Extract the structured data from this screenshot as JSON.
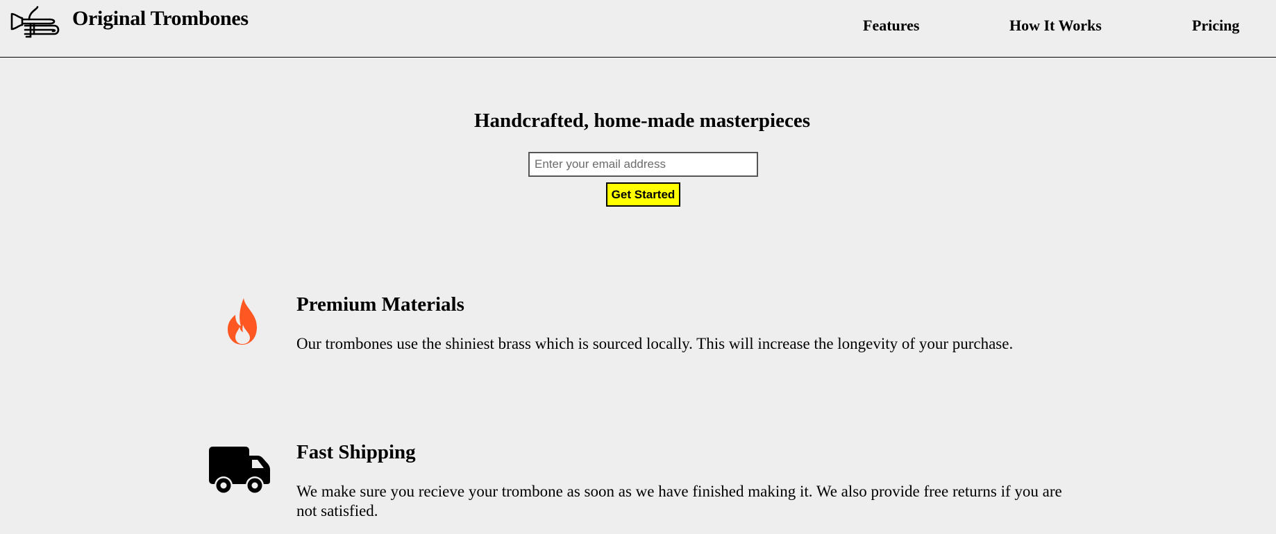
{
  "header": {
    "brand": "Original Trombones",
    "logo_icon": "trombone-icon",
    "nav": {
      "features": "Features",
      "how_it_works": "How It Works",
      "pricing": "Pricing"
    }
  },
  "hero": {
    "title": "Handcrafted, home-made masterpieces",
    "email_placeholder": "Enter your email address",
    "email_value": "",
    "submit_label": "Get Started",
    "submit_color": "#ffff00"
  },
  "features": [
    {
      "icon": "flame-icon",
      "title": "Premium Materials",
      "description": "Our trombones use the shiniest brass which is sourced locally. This will increase the longevity of your purchase."
    },
    {
      "icon": "truck-icon",
      "title": "Fast Shipping",
      "description": "We make sure you recieve your trombone as soon as we have finished making it. We also provide free returns if you are not satisfied."
    }
  ],
  "colors": {
    "background": "#eeeeee",
    "accent_button": "#ffff00",
    "flame": "#ff5722"
  }
}
